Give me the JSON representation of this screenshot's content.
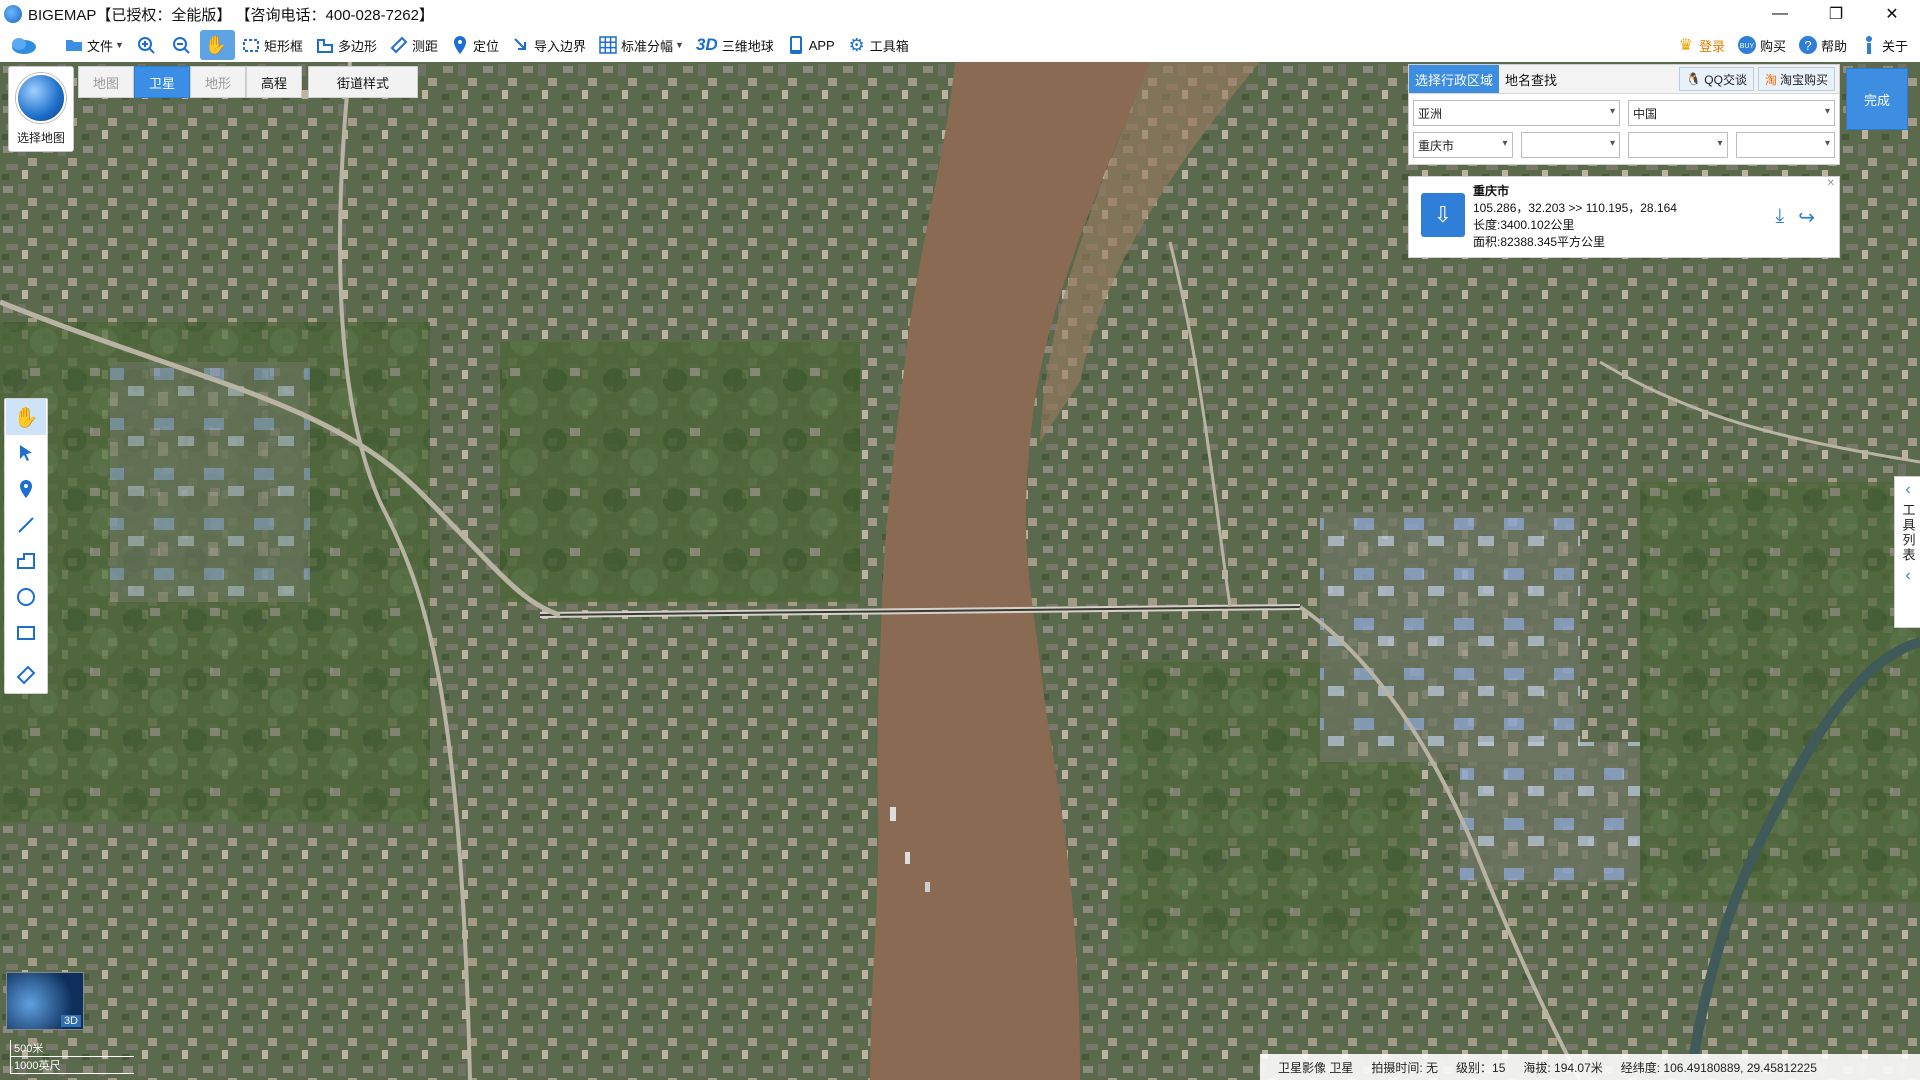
{
  "window": {
    "title": "BIGEMAP【已授权：全能版】 【咨询电话：400-028-7262】",
    "controls": [
      "—",
      "❐",
      "✕"
    ]
  },
  "toolbar": {
    "file": "文件",
    "rect": "矩形框",
    "polygon": "多边形",
    "measure": "测距",
    "locate": "定位",
    "import_boundary": "导入边界",
    "standard_sheet": "标准分幅",
    "globe_3d_badge": "3D",
    "globe_3d": "三维地球",
    "app": "APP",
    "toolbox": "工具箱",
    "login": "登录",
    "buy": "购买",
    "help": "帮助",
    "about": "关于"
  },
  "map_switcher": {
    "select_map": "选择地图",
    "tabs": [
      "地图",
      "卫星",
      "地形",
      "高程"
    ],
    "active_tab": "卫星",
    "street_style": "街道样式"
  },
  "region_panel": {
    "tabs": [
      "选择行政区域",
      "地名查找"
    ],
    "active_tab": "选择行政区域",
    "qq": "QQ交谈",
    "taobao": "淘宝购买",
    "continent": "亚洲",
    "country": "中国",
    "city": "重庆市",
    "district": "",
    "town": "",
    "village": ""
  },
  "info_card": {
    "name": "重庆市",
    "coords": "105.286，32.203 >> 110.195，28.164",
    "length": "长度:3400.102公里",
    "area": "面积:82388.345平方公里"
  },
  "finish_button": "完成",
  "side_toollist": "工具列表",
  "scale": {
    "metric": "500米",
    "imperial": "1000英尺"
  },
  "globe_badge": "3D",
  "statusbar": {
    "imagery": "卫星影像 卫星",
    "capture_time": "拍摄时间: 无",
    "level": "级别：15",
    "altitude": "海拔: 194.07米",
    "lonlat": "经纬度: 106.49180889, 29.45812225"
  },
  "colors": {
    "accent": "#3d8ee0",
    "river": "#8a6a52",
    "vegetation": "#4f6a3c"
  }
}
